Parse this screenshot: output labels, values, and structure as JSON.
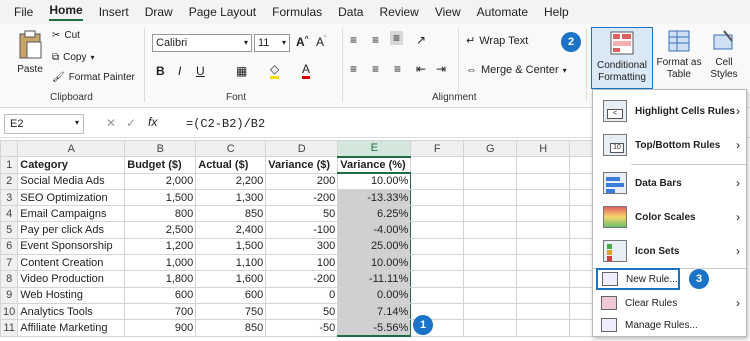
{
  "menu": [
    "File",
    "Home",
    "Insert",
    "Draw",
    "Page Layout",
    "Formulas",
    "Data",
    "Review",
    "View",
    "Automate",
    "Help"
  ],
  "ribbon": {
    "paste": "Paste",
    "cut": "Cut",
    "copy": "Copy",
    "format_painter": "Format Painter",
    "clipboard": "Clipboard",
    "font_name": "Calibri",
    "font_size": "11",
    "font_label": "Font",
    "wrap_text": "Wrap Text",
    "merge_center": "Merge & Center",
    "alignment_label": "Alignment",
    "cond_fmt_1": "Conditional",
    "cond_fmt_2": "Formatting",
    "fmt_table_1": "Format as",
    "fmt_table_2": "Table",
    "cell_styles_1": "Cell",
    "cell_styles_2": "Styles"
  },
  "formula_bar": {
    "name_box": "E2",
    "formula": "=(C2-B2)/B2"
  },
  "columns": [
    "A",
    "B",
    "C",
    "D",
    "E",
    "F",
    "G",
    "H",
    "I"
  ],
  "rows": [
    {
      "n": "1",
      "a": "Category",
      "b": "Budget ($)",
      "c": "Actual ($)",
      "d": "Variance ($)",
      "e": "Variance (%)"
    },
    {
      "n": "2",
      "a": "Social Media Ads",
      "b": "2,000",
      "c": "2,200",
      "d": "200",
      "e": "10.00%"
    },
    {
      "n": "3",
      "a": "SEO Optimization",
      "b": "1,500",
      "c": "1,300",
      "d": "-200",
      "e": "-13.33%"
    },
    {
      "n": "4",
      "a": "Email Campaigns",
      "b": "800",
      "c": "850",
      "d": "50",
      "e": "6.25%"
    },
    {
      "n": "5",
      "a": "Pay per click Ads",
      "b": "2,500",
      "c": "2,400",
      "d": "-100",
      "e": "-4.00%"
    },
    {
      "n": "6",
      "a": "Event Sponsorship",
      "b": "1,200",
      "c": "1,500",
      "d": "300",
      "e": "25.00%"
    },
    {
      "n": "7",
      "a": "Content Creation",
      "b": "1,000",
      "c": "1,100",
      "d": "100",
      "e": "10.00%"
    },
    {
      "n": "8",
      "a": "Video Production",
      "b": "1,800",
      "c": "1,600",
      "d": "-200",
      "e": "-11.11%"
    },
    {
      "n": "9",
      "a": "Web Hosting",
      "b": "600",
      "c": "600",
      "d": "0",
      "e": "0.00%"
    },
    {
      "n": "10",
      "a": "Analytics Tools",
      "b": "700",
      "c": "750",
      "d": "50",
      "e": "7.14%"
    },
    {
      "n": "11",
      "a": "Affiliate Marketing",
      "b": "900",
      "c": "850",
      "d": "-50",
      "e": "-5.56%"
    }
  ],
  "dropdown": {
    "highlight": "Highlight Cells Rules",
    "topbottom": "Top/Bottom Rules",
    "databars": "Data Bars",
    "colorscales": "Color Scales",
    "iconsets": "Icon Sets",
    "newrule": "New Rule...",
    "clearrules": "Clear Rules",
    "managerules": "Manage Rules..."
  },
  "badges": [
    "1",
    "2",
    "3"
  ],
  "accent": "#1f6e43",
  "badge_color": "#1a73c9"
}
